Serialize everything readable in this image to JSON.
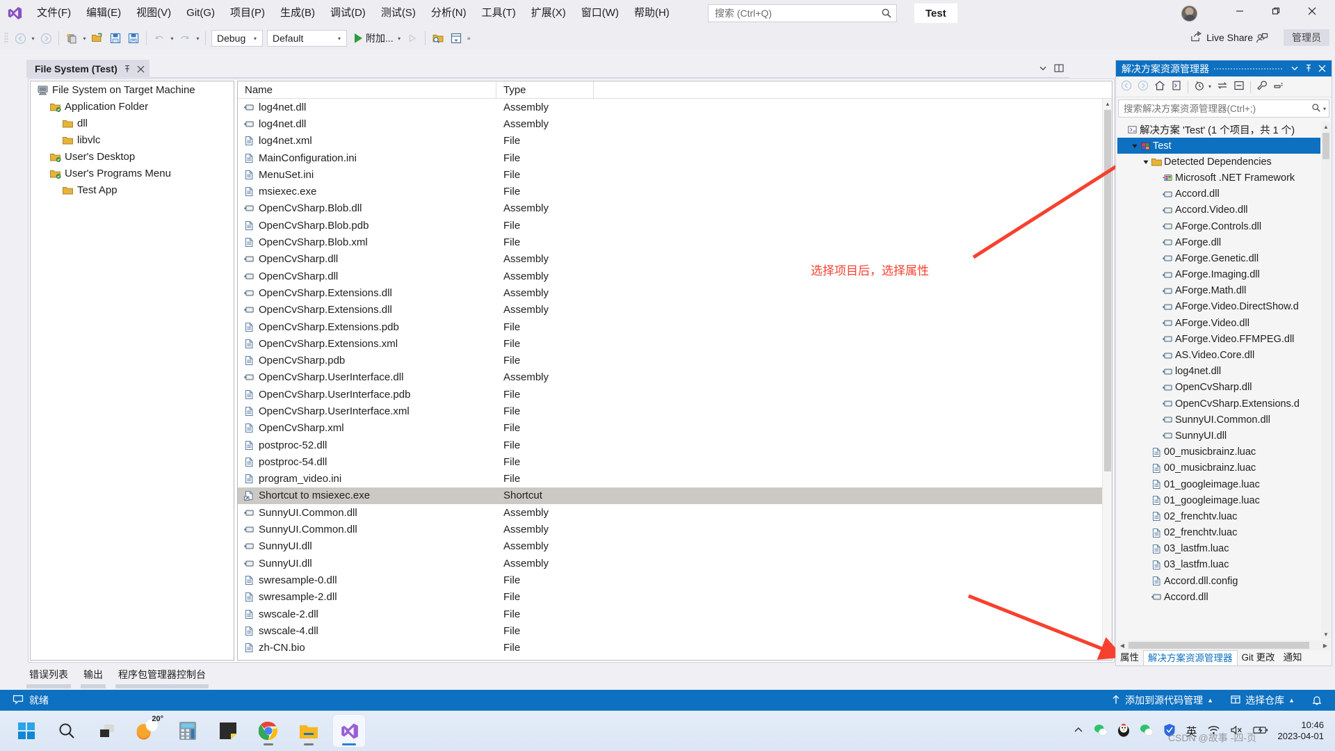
{
  "app": {
    "title_tab": "Test",
    "logo_icon": "visual-studio-logo"
  },
  "menu": {
    "items": [
      {
        "label": "文件(F)",
        "name": "file"
      },
      {
        "label": "编辑(E)",
        "name": "edit"
      },
      {
        "label": "视图(V)",
        "name": "view"
      },
      {
        "label": "Git(G)",
        "name": "git"
      },
      {
        "label": "项目(P)",
        "name": "project"
      },
      {
        "label": "生成(B)",
        "name": "build"
      },
      {
        "label": "调试(D)",
        "name": "debug"
      },
      {
        "label": "测试(S)",
        "name": "test"
      },
      {
        "label": "分析(N)",
        "name": "analyze"
      },
      {
        "label": "工具(T)",
        "name": "tools"
      },
      {
        "label": "扩展(X)",
        "name": "extensions"
      },
      {
        "label": "窗口(W)",
        "name": "window"
      },
      {
        "label": "帮助(H)",
        "name": "help"
      }
    ]
  },
  "search": {
    "placeholder": "搜索 (Ctrl+Q)",
    "value": "",
    "icon": "search-icon"
  },
  "window_controls": {
    "minimize": "—",
    "maximize": "❐",
    "close": "✕"
  },
  "toolbar": {
    "config": "Debug",
    "platform": "Default",
    "run_label": "附加...",
    "live_share": "Live Share",
    "admin": "管理员"
  },
  "document_tab": {
    "label": "File System (Test)",
    "pin_icon": "pin-icon",
    "close_icon": "close-icon"
  },
  "file_system_tree": {
    "nodes": [
      {
        "label": "File System on Target Machine",
        "indent": 0,
        "icon": "computer-icon"
      },
      {
        "label": "Application Folder",
        "indent": 1,
        "icon": "special-folder-icon"
      },
      {
        "label": "dll",
        "indent": 2,
        "icon": "folder-icon"
      },
      {
        "label": "libvlc",
        "indent": 2,
        "icon": "folder-icon"
      },
      {
        "label": "User's Desktop",
        "indent": 1,
        "icon": "special-folder-icon"
      },
      {
        "label": "User's Programs Menu",
        "indent": 1,
        "icon": "special-folder-icon"
      },
      {
        "label": "Test App",
        "indent": 2,
        "icon": "folder-icon"
      }
    ]
  },
  "file_list": {
    "columns": [
      "Name",
      "Type"
    ],
    "rows": [
      {
        "name": "log4net.dll",
        "type": "Assembly",
        "icon": "assembly-icon",
        "selected": false
      },
      {
        "name": "log4net.dll",
        "type": "Assembly",
        "icon": "assembly-icon",
        "selected": false
      },
      {
        "name": "log4net.xml",
        "type": "File",
        "icon": "file-icon",
        "selected": false
      },
      {
        "name": "MainConfiguration.ini",
        "type": "File",
        "icon": "file-icon",
        "selected": false
      },
      {
        "name": "MenuSet.ini",
        "type": "File",
        "icon": "file-icon",
        "selected": false
      },
      {
        "name": "msiexec.exe",
        "type": "File",
        "icon": "file-icon",
        "selected": false
      },
      {
        "name": "OpenCvSharp.Blob.dll",
        "type": "Assembly",
        "icon": "assembly-icon",
        "selected": false
      },
      {
        "name": "OpenCvSharp.Blob.pdb",
        "type": "File",
        "icon": "file-icon",
        "selected": false
      },
      {
        "name": "OpenCvSharp.Blob.xml",
        "type": "File",
        "icon": "file-icon",
        "selected": false
      },
      {
        "name": "OpenCvSharp.dll",
        "type": "Assembly",
        "icon": "assembly-icon",
        "selected": false
      },
      {
        "name": "OpenCvSharp.dll",
        "type": "Assembly",
        "icon": "assembly-icon",
        "selected": false
      },
      {
        "name": "OpenCvSharp.Extensions.dll",
        "type": "Assembly",
        "icon": "assembly-icon",
        "selected": false
      },
      {
        "name": "OpenCvSharp.Extensions.dll",
        "type": "Assembly",
        "icon": "assembly-icon",
        "selected": false
      },
      {
        "name": "OpenCvSharp.Extensions.pdb",
        "type": "File",
        "icon": "file-icon",
        "selected": false
      },
      {
        "name": "OpenCvSharp.Extensions.xml",
        "type": "File",
        "icon": "file-icon",
        "selected": false
      },
      {
        "name": "OpenCvSharp.pdb",
        "type": "File",
        "icon": "file-icon",
        "selected": false
      },
      {
        "name": "OpenCvSharp.UserInterface.dll",
        "type": "Assembly",
        "icon": "assembly-icon",
        "selected": false
      },
      {
        "name": "OpenCvSharp.UserInterface.pdb",
        "type": "File",
        "icon": "file-icon",
        "selected": false
      },
      {
        "name": "OpenCvSharp.UserInterface.xml",
        "type": "File",
        "icon": "file-icon",
        "selected": false
      },
      {
        "name": "OpenCvSharp.xml",
        "type": "File",
        "icon": "file-icon",
        "selected": false
      },
      {
        "name": "postproc-52.dll",
        "type": "File",
        "icon": "file-icon",
        "selected": false
      },
      {
        "name": "postproc-54.dll",
        "type": "File",
        "icon": "file-icon",
        "selected": false
      },
      {
        "name": "program_video.ini",
        "type": "File",
        "icon": "file-icon",
        "selected": false
      },
      {
        "name": "Shortcut to msiexec.exe",
        "type": "Shortcut",
        "icon": "shortcut-icon",
        "selected": true
      },
      {
        "name": "SunnyUI.Common.dll",
        "type": "Assembly",
        "icon": "assembly-icon",
        "selected": false
      },
      {
        "name": "SunnyUI.Common.dll",
        "type": "Assembly",
        "icon": "assembly-icon",
        "selected": false
      },
      {
        "name": "SunnyUI.dll",
        "type": "Assembly",
        "icon": "assembly-icon",
        "selected": false
      },
      {
        "name": "SunnyUI.dll",
        "type": "Assembly",
        "icon": "assembly-icon",
        "selected": false
      },
      {
        "name": "swresample-0.dll",
        "type": "File",
        "icon": "file-icon",
        "selected": false
      },
      {
        "name": "swresample-2.dll",
        "type": "File",
        "icon": "file-icon",
        "selected": false
      },
      {
        "name": "swscale-2.dll",
        "type": "File",
        "icon": "file-icon",
        "selected": false
      },
      {
        "name": "swscale-4.dll",
        "type": "File",
        "icon": "file-icon",
        "selected": false
      },
      {
        "name": "zh-CN.bio",
        "type": "File",
        "icon": "file-icon",
        "selected": false
      }
    ]
  },
  "annotation": {
    "text": "选择项目后，选择属性",
    "color": "#f8402f"
  },
  "solution_explorer": {
    "title": "解决方案资源管理器",
    "dropdown_icon": "chevron-down-icon",
    "pin_icon": "pin-icon",
    "close_icon": "close-icon",
    "search_placeholder": "搜索解决方案资源管理器(Ctrl+;)",
    "search_value": "",
    "solution_label": "解决方案 'Test' (1 个项目，共 1 个)",
    "nodes": [
      {
        "label": "Test",
        "indent": 1,
        "icon": "project-icon",
        "selected": true,
        "expander": "expanded"
      },
      {
        "label": "Detected Dependencies",
        "indent": 2,
        "icon": "folder-icon",
        "selected": false,
        "expander": "expanded"
      },
      {
        "label": "Microsoft .NET Framework",
        "indent": 3,
        "icon": "framework-icon",
        "selected": false,
        "expander": ""
      },
      {
        "label": "Accord.dll",
        "indent": 3,
        "icon": "reference-icon",
        "selected": false,
        "expander": ""
      },
      {
        "label": "Accord.Video.dll",
        "indent": 3,
        "icon": "reference-icon",
        "selected": false,
        "expander": ""
      },
      {
        "label": "AForge.Controls.dll",
        "indent": 3,
        "icon": "reference-icon",
        "selected": false,
        "expander": ""
      },
      {
        "label": "AForge.dll",
        "indent": 3,
        "icon": "reference-icon",
        "selected": false,
        "expander": ""
      },
      {
        "label": "AForge.Genetic.dll",
        "indent": 3,
        "icon": "reference-icon",
        "selected": false,
        "expander": ""
      },
      {
        "label": "AForge.Imaging.dll",
        "indent": 3,
        "icon": "reference-icon",
        "selected": false,
        "expander": ""
      },
      {
        "label": "AForge.Math.dll",
        "indent": 3,
        "icon": "reference-icon",
        "selected": false,
        "expander": ""
      },
      {
        "label": "AForge.Video.DirectShow.d",
        "indent": 3,
        "icon": "reference-icon",
        "selected": false,
        "expander": ""
      },
      {
        "label": "AForge.Video.dll",
        "indent": 3,
        "icon": "reference-icon",
        "selected": false,
        "expander": ""
      },
      {
        "label": "AForge.Video.FFMPEG.dll",
        "indent": 3,
        "icon": "reference-icon",
        "selected": false,
        "expander": ""
      },
      {
        "label": "AS.Video.Core.dll",
        "indent": 3,
        "icon": "reference-icon",
        "selected": false,
        "expander": ""
      },
      {
        "label": "log4net.dll",
        "indent": 3,
        "icon": "reference-icon",
        "selected": false,
        "expander": ""
      },
      {
        "label": "OpenCvSharp.dll",
        "indent": 3,
        "icon": "reference-icon",
        "selected": false,
        "expander": ""
      },
      {
        "label": "OpenCvSharp.Extensions.d",
        "indent": 3,
        "icon": "reference-icon",
        "selected": false,
        "expander": ""
      },
      {
        "label": "SunnyUI.Common.dll",
        "indent": 3,
        "icon": "reference-icon",
        "selected": false,
        "expander": ""
      },
      {
        "label": "SunnyUI.dll",
        "indent": 3,
        "icon": "reference-icon",
        "selected": false,
        "expander": ""
      },
      {
        "label": "00_musicbrainz.luac",
        "indent": 2,
        "icon": "file-icon",
        "selected": false,
        "expander": ""
      },
      {
        "label": "00_musicbrainz.luac",
        "indent": 2,
        "icon": "file-icon",
        "selected": false,
        "expander": ""
      },
      {
        "label": "01_googleimage.luac",
        "indent": 2,
        "icon": "file-icon",
        "selected": false,
        "expander": ""
      },
      {
        "label": "01_googleimage.luac",
        "indent": 2,
        "icon": "file-icon",
        "selected": false,
        "expander": ""
      },
      {
        "label": "02_frenchtv.luac",
        "indent": 2,
        "icon": "file-icon",
        "selected": false,
        "expander": ""
      },
      {
        "label": "02_frenchtv.luac",
        "indent": 2,
        "icon": "file-icon",
        "selected": false,
        "expander": ""
      },
      {
        "label": "03_lastfm.luac",
        "indent": 2,
        "icon": "file-icon",
        "selected": false,
        "expander": ""
      },
      {
        "label": "03_lastfm.luac",
        "indent": 2,
        "icon": "file-icon",
        "selected": false,
        "expander": ""
      },
      {
        "label": "Accord.dll.config",
        "indent": 2,
        "icon": "file-icon",
        "selected": false,
        "expander": ""
      },
      {
        "label": "Accord.dll",
        "indent": 2,
        "icon": "reference-icon",
        "selected": false,
        "expander": ""
      }
    ],
    "bottom_tabs": [
      {
        "label": "属性",
        "name": "properties",
        "active": false
      },
      {
        "label": "解决方案资源管理器",
        "name": "solution-explorer",
        "active": true
      },
      {
        "label": "Git 更改",
        "name": "git-changes",
        "active": false
      },
      {
        "label": "通知",
        "name": "notifications",
        "active": false
      }
    ]
  },
  "output_tabs": [
    {
      "label": "错误列表",
      "name": "error-list"
    },
    {
      "label": "输出",
      "name": "output"
    },
    {
      "label": "程序包管理器控制台",
      "name": "package-manager-console"
    }
  ],
  "status_bar": {
    "ready": "就绪",
    "source_control": "添加到源代码管理",
    "repository": "选择仓库",
    "bell_icon": "bell-icon"
  },
  "taskbar": {
    "weather_temp": "20°",
    "items": [
      {
        "name": "start-button",
        "icon": "windows-logo"
      },
      {
        "name": "search-button",
        "icon": "search-icon"
      },
      {
        "name": "task-view-button",
        "icon": "task-view-icon"
      },
      {
        "name": "weather-widget",
        "icon": "weather-icon"
      },
      {
        "name": "calculator-app",
        "icon": "calculator-icon"
      },
      {
        "name": "notepad-app",
        "icon": "notepad-icon"
      },
      {
        "name": "chrome-app",
        "icon": "chrome-icon"
      },
      {
        "name": "file-explorer-app",
        "icon": "folder-icon"
      },
      {
        "name": "visual-studio-app",
        "icon": "visual-studio-logo"
      }
    ],
    "tray": [
      {
        "name": "tray-overflow",
        "icon": "chevron-up-icon"
      },
      {
        "name": "wechat-tray",
        "icon": "wechat-icon"
      },
      {
        "name": "qq-tray",
        "icon": "qq-icon"
      },
      {
        "name": "wechat-work-tray",
        "icon": "wechat-icon"
      },
      {
        "name": "tencent-security-tray",
        "icon": "shield-icon"
      },
      {
        "name": "ime-indicator",
        "icon": "ime-icon",
        "label": "英"
      },
      {
        "name": "network-icon",
        "icon": "wifi-icon"
      },
      {
        "name": "volume-icon",
        "icon": "speaker-muted-icon"
      },
      {
        "name": "battery-icon",
        "icon": "battery-icon"
      }
    ],
    "clock_time": "10:46",
    "clock_date": "2023-04-01"
  },
  "watermark": "CSDN @故事 -四-页"
}
